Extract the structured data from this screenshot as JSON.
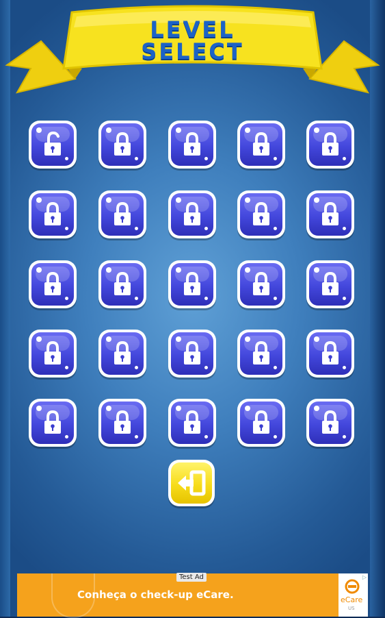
{
  "title": {
    "line1": "LEVEL",
    "line2": "SELECT"
  },
  "levels": [
    {
      "state": "unlocked"
    },
    {
      "state": "locked"
    },
    {
      "state": "locked"
    },
    {
      "state": "locked"
    },
    {
      "state": "locked"
    },
    {
      "state": "locked"
    },
    {
      "state": "locked"
    },
    {
      "state": "locked"
    },
    {
      "state": "locked"
    },
    {
      "state": "locked"
    },
    {
      "state": "locked"
    },
    {
      "state": "locked"
    },
    {
      "state": "locked"
    },
    {
      "state": "locked"
    },
    {
      "state": "locked"
    },
    {
      "state": "locked"
    },
    {
      "state": "locked"
    },
    {
      "state": "locked"
    },
    {
      "state": "locked"
    },
    {
      "state": "locked"
    },
    {
      "state": "locked"
    },
    {
      "state": "locked"
    },
    {
      "state": "locked"
    },
    {
      "state": "locked"
    },
    {
      "state": "locked"
    }
  ],
  "exit_button": {
    "icon": "exit-icon"
  },
  "ad": {
    "tag": "Test Ad",
    "text": "Conheça o check-up eCare.",
    "brand": "eCare",
    "brand_sub": "US",
    "info": "▷"
  },
  "colors": {
    "tile_blue": "#4347dc",
    "banner_yellow": "#f7e21f",
    "title_blue": "#1c63c6",
    "exit_yellow": "#f7dc1a",
    "ad_orange": "#f5a21c"
  }
}
